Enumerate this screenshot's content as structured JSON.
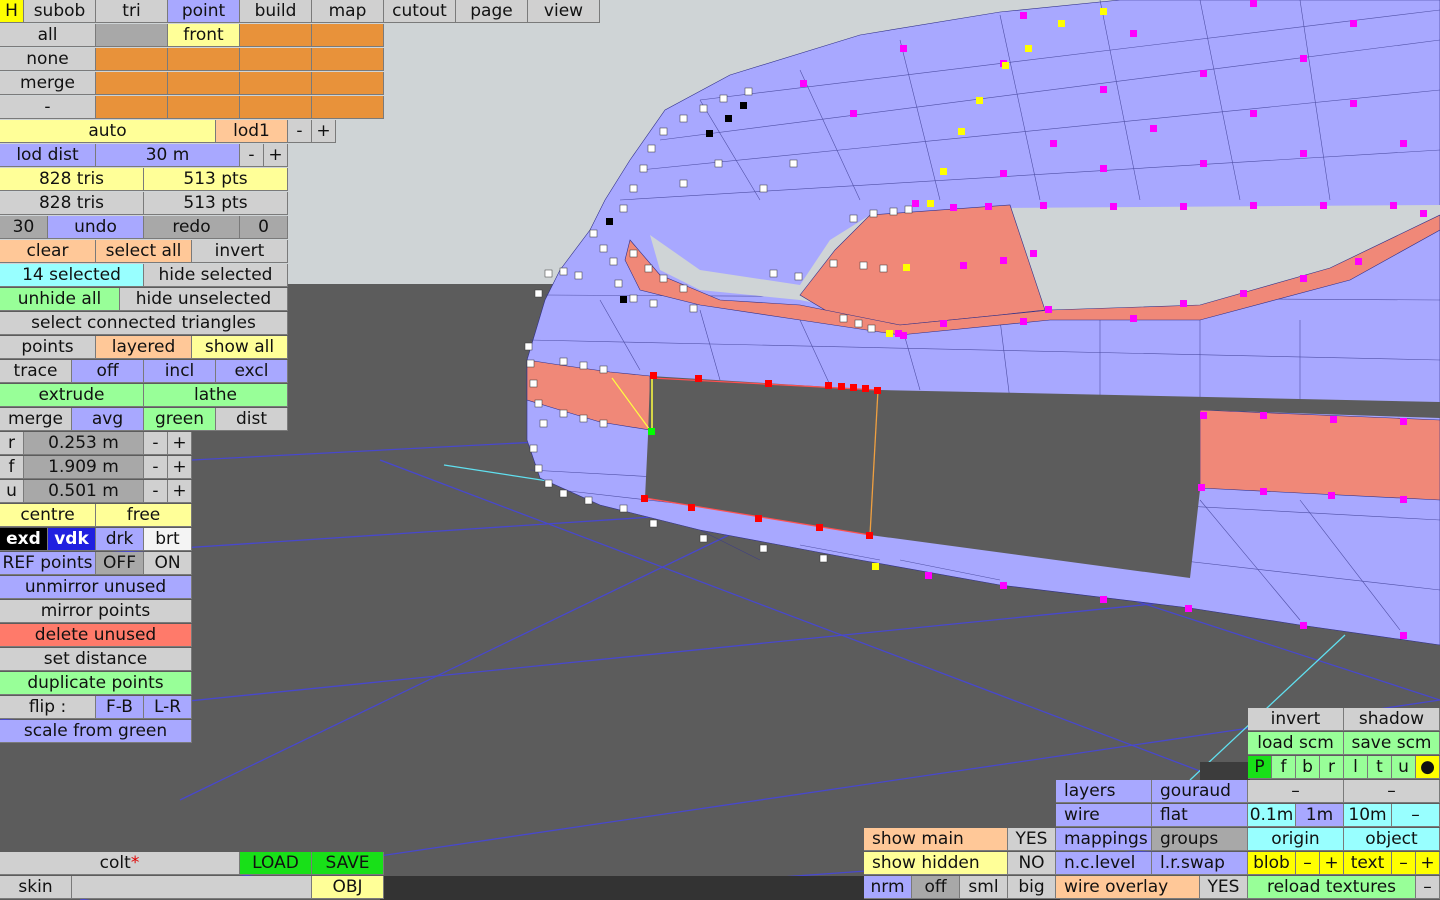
{
  "colors": {
    "mesh_fill": "#a8a8ff",
    "selected_faces": "#f08878",
    "point_magenta": "#ff00ff",
    "point_yellow": "#ffff00",
    "point_red": "#ff0000",
    "point_white": "#ffffff",
    "sky": "#cfd4d6",
    "ground": "#5c5c5c",
    "grid": "#4848cc"
  },
  "menu": {
    "h": "H",
    "tabs": [
      "subob",
      "tri",
      "point",
      "build",
      "map",
      "cutout",
      "page",
      "view"
    ],
    "active_tab": "point"
  },
  "selection_grid": {
    "row_labels": [
      "all",
      "none",
      "merge",
      "-"
    ],
    "front": "front"
  },
  "lod": {
    "auto": "auto",
    "lod1": "lod1",
    "minus": "-",
    "plus": "+",
    "dist_label": "lod dist",
    "dist_value": "30 m"
  },
  "stats": {
    "tris_1": "828 tris",
    "pts_1": "513 pts",
    "tris_2": "828 tris",
    "pts_2": "513 pts",
    "undo_count": "30",
    "undo": "undo",
    "redo": "redo",
    "redo_count": "0"
  },
  "actions": {
    "clear": "clear",
    "select_all": "select all",
    "invert": "invert",
    "selected_count": "14 selected",
    "hide_selected": "hide selected",
    "unhide_all": "unhide all",
    "hide_unselected": "hide unselected",
    "select_connected": "select connected triangles",
    "points": "points",
    "layered": "layered",
    "show_all": "show all",
    "trace": "trace",
    "off": "off",
    "incl": "incl",
    "excl": "excl",
    "extrude": "extrude",
    "lathe": "lathe",
    "merge": "merge",
    "avg": "avg",
    "green": "green",
    "dist": "dist"
  },
  "coords": {
    "r_label": "r",
    "r_value": "0.253 m",
    "f_label": "f",
    "f_value": "1.909 m",
    "u_label": "u",
    "u_value": "0.501 m",
    "minus": "-",
    "plus": "+"
  },
  "tools": {
    "centre": "centre",
    "free": "free",
    "exd": "exd",
    "vdk": "vdk",
    "drk": "drk",
    "brt": "brt",
    "ref_points": "REF points",
    "off": "OFF",
    "on": "ON",
    "unmirror_unused": "unmirror unused",
    "mirror_points": "mirror points",
    "delete_unused": "delete unused",
    "set_distance": "set distance",
    "duplicate_points": "duplicate points",
    "flip": "flip :",
    "fb": "F-B",
    "lr": "L-R",
    "scale_from_green": "scale from green"
  },
  "file": {
    "name": "colt",
    "modified_mark": "*",
    "load": "LOAD",
    "save": "SAVE",
    "skin": "skin",
    "obj": "OBJ"
  },
  "display": {
    "show_main": "show main",
    "show_main_value": "YES",
    "show_hidden": "show hidden",
    "show_hidden_value": "NO",
    "nrm": "nrm",
    "off": "off",
    "sml": "sml",
    "big": "big",
    "layers": "layers",
    "gouraud": "gouraud",
    "wire": "wire",
    "flat": "flat",
    "mappings": "mappings",
    "groups": "groups",
    "nc_level": "n.c.level",
    "lr_swap": "l.r.swap",
    "wire_overlay": "wire overlay",
    "wire_overlay_value": "YES"
  },
  "right_panel": {
    "invert": "invert",
    "shadow": "shadow",
    "load_scm": "load scm",
    "save_scm": "save scm",
    "views": [
      "P",
      "f",
      "b",
      "r",
      "l",
      "t",
      "u"
    ],
    "dot": "●",
    "dash": "–",
    "grid_01": "0.1m",
    "grid_1": "1m",
    "grid_10": "10m",
    "grid_dash": "–",
    "origin": "origin",
    "object": "object",
    "blob": "blob",
    "text": "text",
    "minus": "–",
    "plus": "+",
    "reload_textures": "reload textures"
  }
}
